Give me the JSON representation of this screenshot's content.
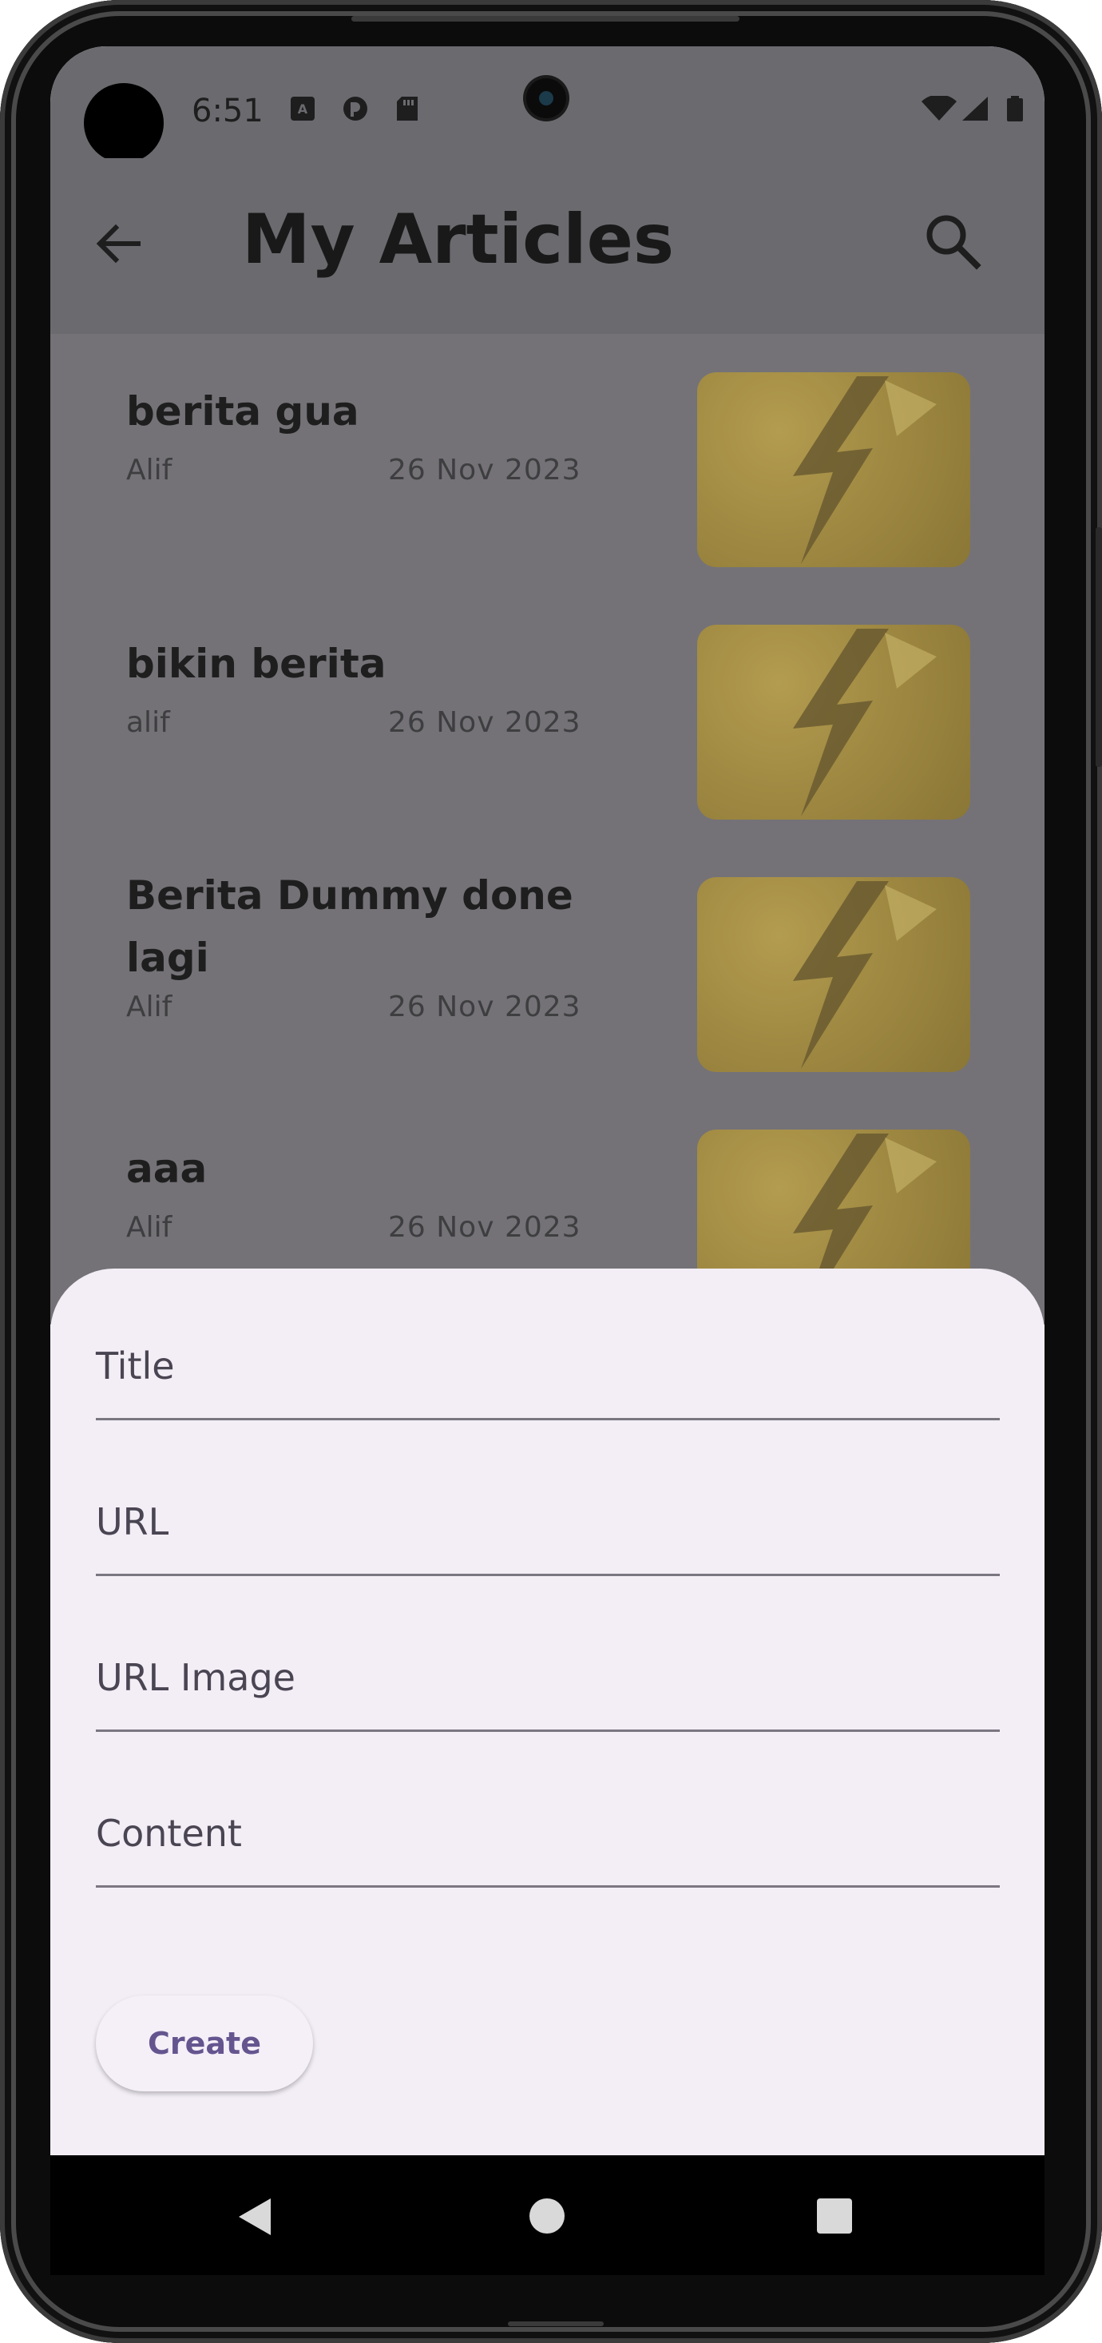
{
  "status_bar": {
    "time": "6:51"
  },
  "app_bar": {
    "title": "My Articles"
  },
  "articles": [
    {
      "title": "berita gua",
      "author": "Alif",
      "date": "26 Nov 2023"
    },
    {
      "title": "bikin berita",
      "author": "alif",
      "date": "26 Nov 2023"
    },
    {
      "title": "Berita Dummy done lagi",
      "author": "Alif",
      "date": "26 Nov 2023"
    },
    {
      "title": "aaa",
      "author": "Alif",
      "date": "26 Nov 2023"
    }
  ],
  "form": {
    "title_label": "Title",
    "url_label": "URL",
    "url_image_label": "URL Image",
    "content_label": "Content",
    "create_label": "Create"
  },
  "colors": {
    "accent": "#65558f",
    "sheet_bg": "#f3eef6",
    "scrim": "#6b6a6f"
  }
}
